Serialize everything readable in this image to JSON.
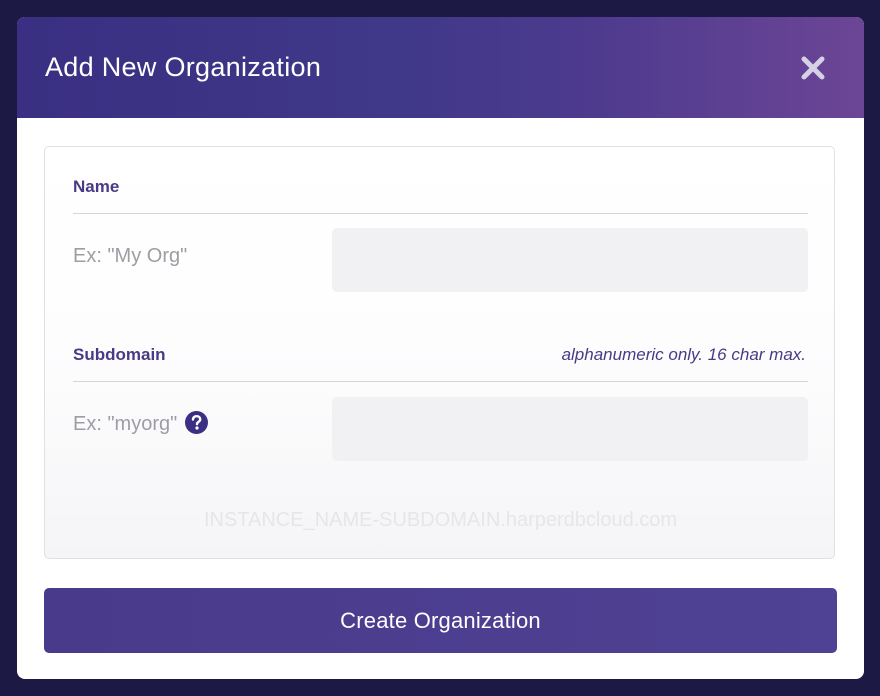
{
  "modal": {
    "title": "Add New Organization",
    "close_icon": "close-icon"
  },
  "name_section": {
    "label": "Name",
    "placeholder_label": "Ex: \"My Org\"",
    "input_value": ""
  },
  "subdomain_section": {
    "label": "Subdomain",
    "hint": "alphanumeric only. 16 char max.",
    "placeholder_label": "Ex: \"myorg\"",
    "help_icon": "question-circle-icon",
    "input_value": ""
  },
  "url_preview": "INSTANCE_NAME-SUBDOMAIN.harperdbcloud.com",
  "create_button_label": "Create Organization",
  "colors": {
    "background": "#1c1a45",
    "header_gradient_start": "#3a2f82",
    "header_gradient_end": "#6c4596",
    "accent": "#4a3a86",
    "button": "#4a3a8c"
  }
}
